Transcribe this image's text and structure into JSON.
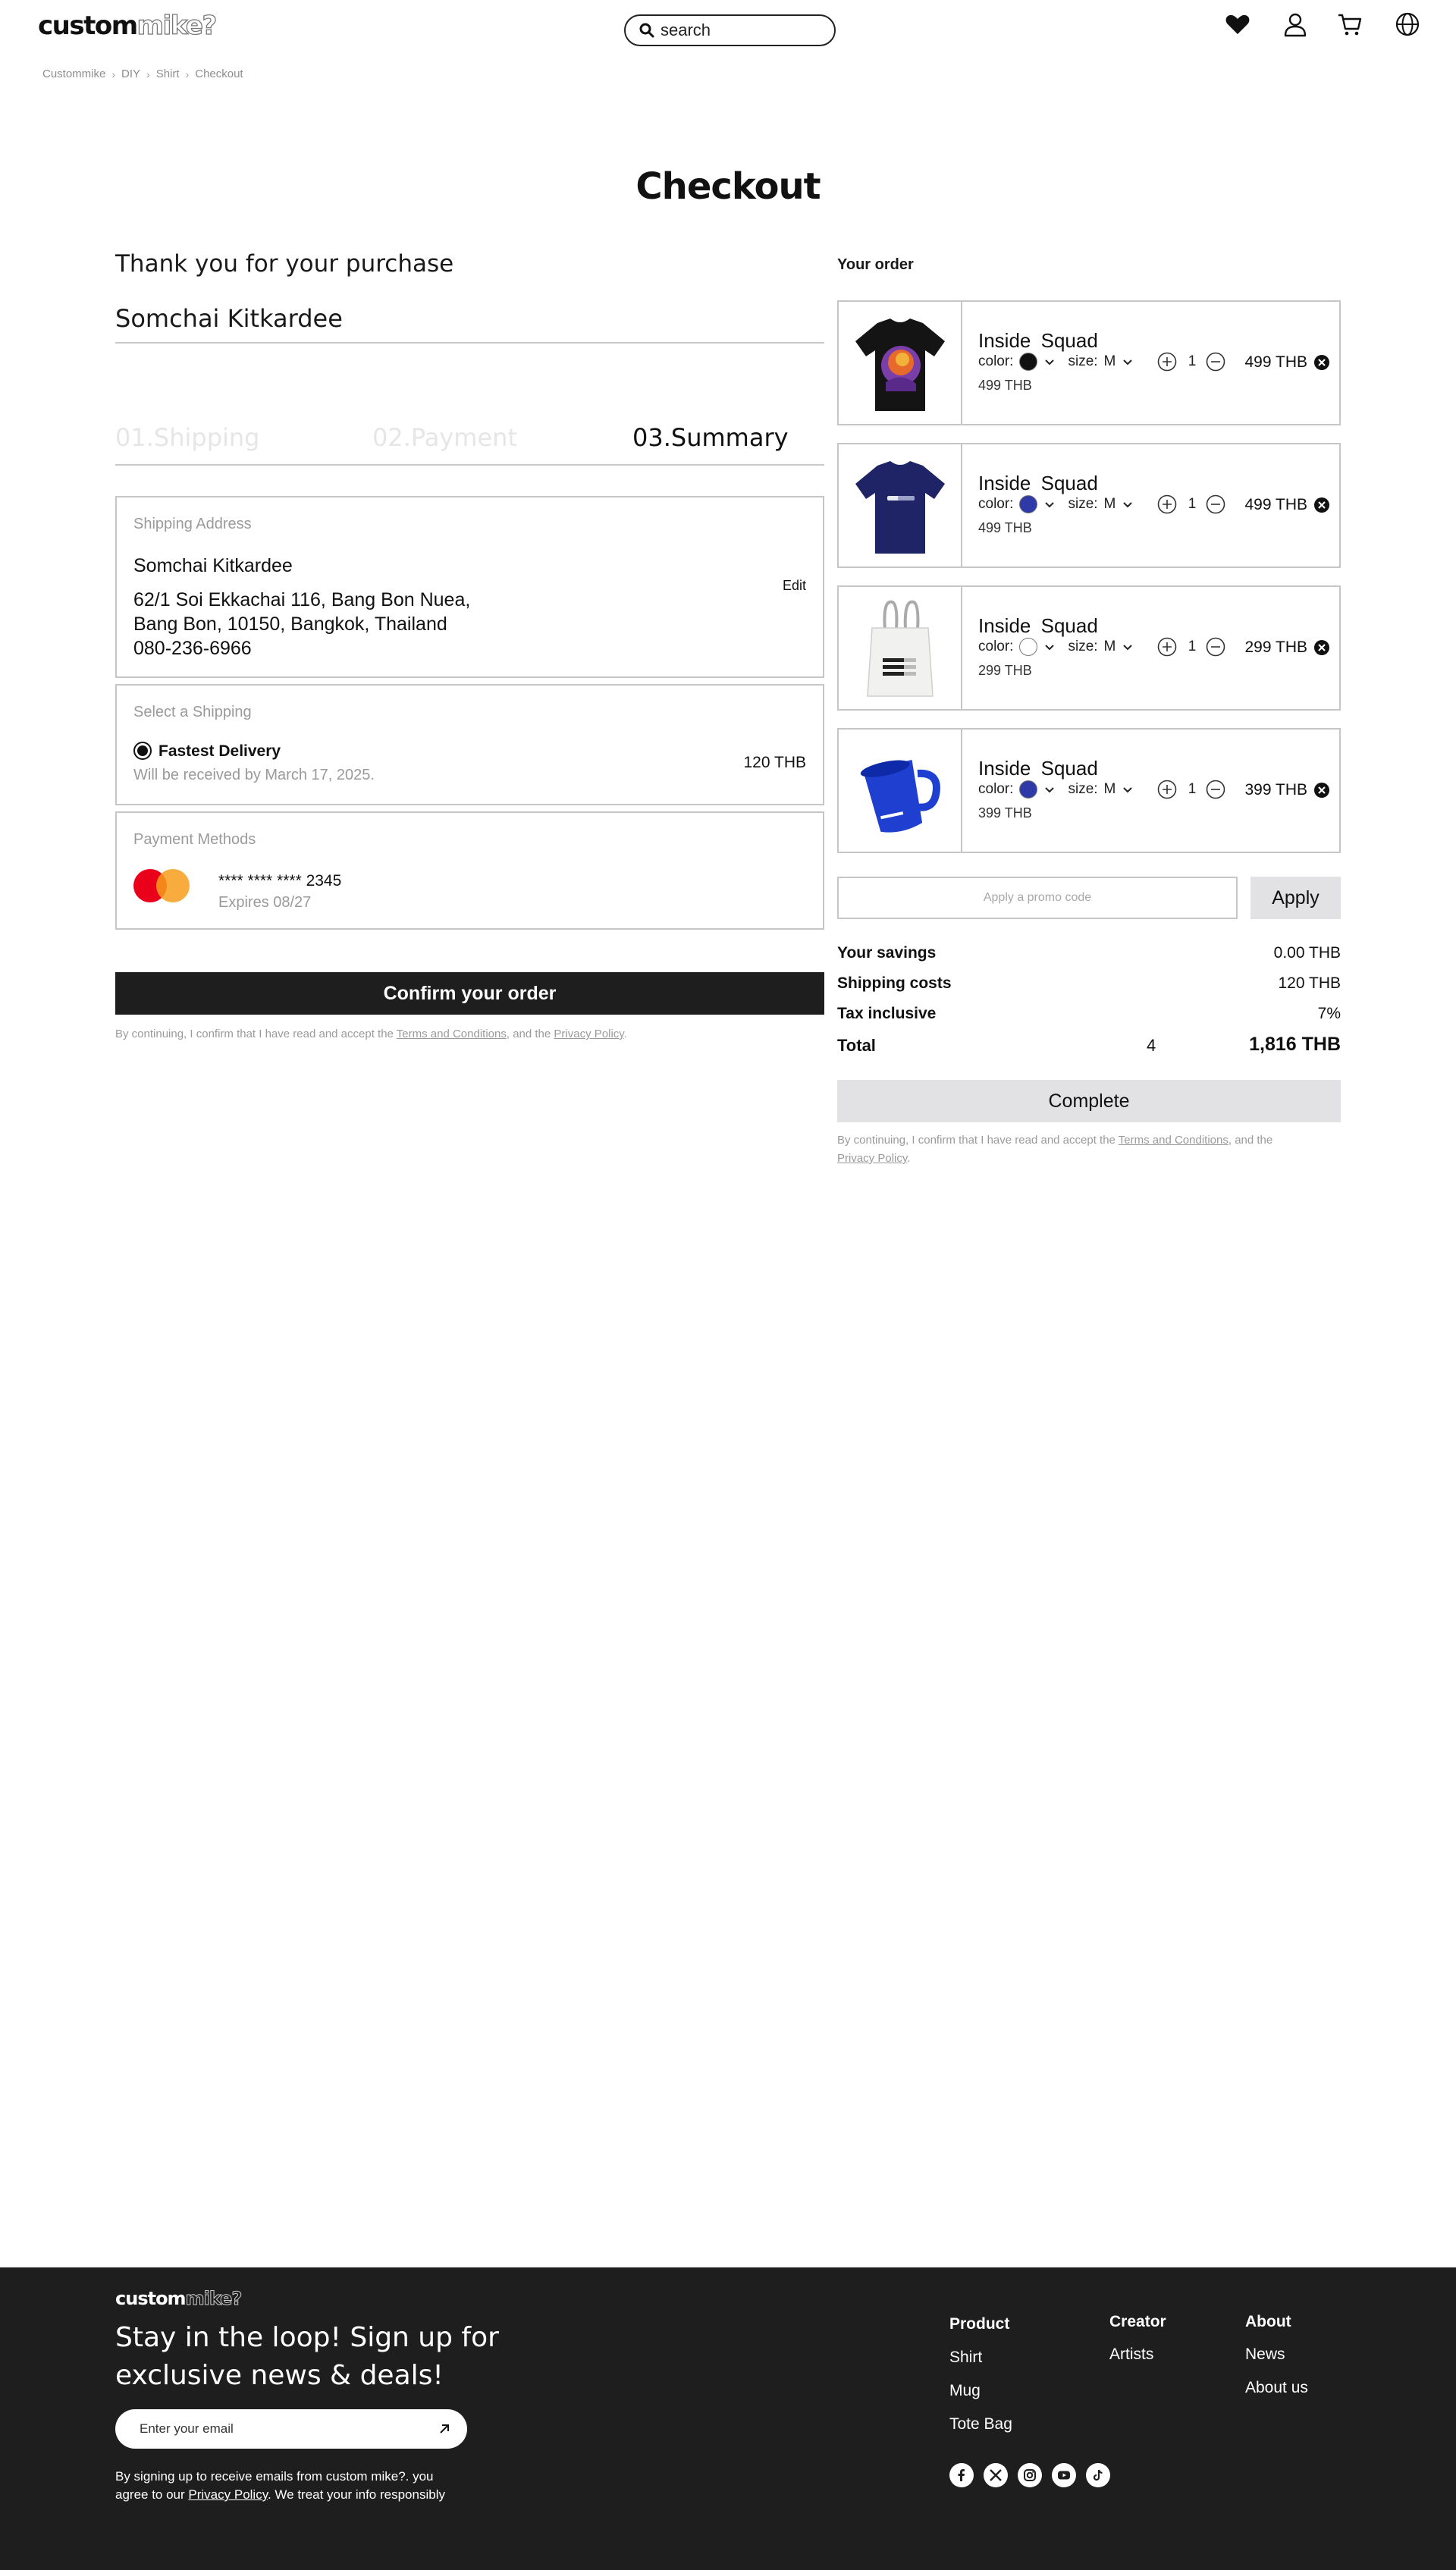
{
  "header": {
    "logo_part1": "custom",
    "logo_part2": "mike?",
    "search_placeholder": "search",
    "icons": [
      "heart-icon",
      "user-icon",
      "cart-icon",
      "globe-icon"
    ]
  },
  "breadcrumb": [
    "Custommike",
    "DIY",
    "Shirt",
    "Checkout"
  ],
  "page_title": "Checkout",
  "left": {
    "thanks": "Thank you for your purchase",
    "customer_name": "Somchai Kitkardee",
    "steps": [
      {
        "label": "01.Shipping",
        "state": "done"
      },
      {
        "label": "02.Payment",
        "state": "done"
      },
      {
        "label": "03.Summary",
        "state": "active"
      }
    ],
    "shipping_address": {
      "label": "Shipping Address",
      "name": "Somchai Kitkardee",
      "line1": "62/1 Soi Ekkachai 116, Bang Bon Nuea,",
      "line2": "Bang Bon, 10150, Bangkok, Thailand",
      "phone": "080-236-6966",
      "edit": "Edit"
    },
    "shipping_method": {
      "label": "Select a Shipping",
      "option": "Fastest Delivery",
      "note": "Will be received by March 17, 2025.",
      "price": "120 THB"
    },
    "payment": {
      "label": "Payment Methods",
      "card_number": "**** **** **** 2345",
      "expires": "Expires 08/27"
    },
    "confirm_button": "Confirm your order",
    "consent": {
      "prefix": "By continuing, I confirm that I have read and accept the ",
      "terms": "Terms and Conditions",
      "middle": ", and the ",
      "privacy": "Privacy Policy",
      "suffix": "."
    }
  },
  "order": {
    "title": "Your order",
    "color_label": "color:",
    "size_label": "size:",
    "items": [
      {
        "title": "Inside  Squad",
        "color": "#111111",
        "size": "M",
        "qty": "1",
        "unit_price": "499 THB",
        "total": "499 THB",
        "kind": "black-tshirt"
      },
      {
        "title": "Inside  Squad",
        "color": "#2e3aa8",
        "size": "M",
        "qty": "1",
        "unit_price": "499 THB",
        "total": "499 THB",
        "kind": "navy-tshirt"
      },
      {
        "title": "Inside  Squad",
        "color": "#ffffff",
        "size": "M",
        "qty": "1",
        "unit_price": "299 THB",
        "total": "299 THB",
        "kind": "tote-bag"
      },
      {
        "title": "Inside  Squad",
        "color": "#2e3aa8",
        "size": "M",
        "qty": "1",
        "unit_price": "399 THB",
        "total": "399 THB",
        "kind": "blue-mug"
      }
    ],
    "promo_placeholder": "Apply a promo code",
    "apply_button": "Apply",
    "summary": {
      "savings_label": "Your savings",
      "savings_value": "0.00 THB",
      "shipping_label": "Shipping costs",
      "shipping_value": "120 THB",
      "tax_label": "Tax inclusive",
      "tax_value": "7%",
      "total_label": "Total",
      "total_count": "4",
      "total_value": "1,816 THB"
    },
    "complete_button": "Complete",
    "consent": {
      "prefix": "By continuing, I confirm that I have read and accept the ",
      "terms": "Terms and Conditions",
      "middle": ", and the",
      "privacy": "Privacy Policy",
      "suffix": "."
    }
  },
  "footer": {
    "logo_part1": "custom",
    "logo_part2": "mike?",
    "headline": "Stay in the loop! Sign up for exclusive news & deals!",
    "email_placeholder": "Enter your email",
    "note_prefix": "By signing up to receive emails from custom mike?. you agree to our ",
    "note_privacy": "Privacy Policy",
    "note_suffix": ".  We treat your info responsibly",
    "columns": {
      "product": {
        "title": "Product",
        "links": [
          "Shirt",
          "Mug",
          "Tote Bag"
        ]
      },
      "creator": {
        "title": "Creator",
        "links": [
          "Artists"
        ]
      },
      "about": {
        "title": "About",
        "links": [
          "News",
          "About us"
        ]
      }
    },
    "social_icons": [
      "facebook-icon",
      "x-icon",
      "instagram-icon",
      "youtube-icon",
      "tiktok-icon"
    ]
  }
}
